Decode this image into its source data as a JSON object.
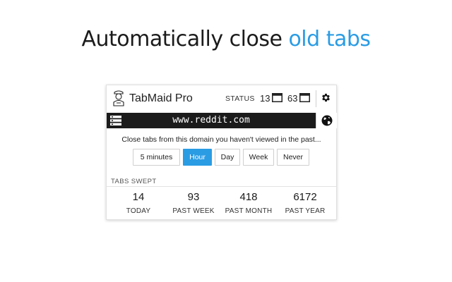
{
  "headline": {
    "prefix": "Automatically close ",
    "accent": "old tabs",
    "accent_color": "#2a9ce4"
  },
  "app": {
    "title": "TabMaid Pro",
    "logo_icon": "maid-icon"
  },
  "status": {
    "label": "STATUS",
    "count_a": "13",
    "count_b": "63",
    "window_icon": "window-icon",
    "settings_icon": "gear-icon"
  },
  "domain": {
    "text": "www.reddit.com",
    "menu_icon": "list-icon",
    "globe_icon": "globe-icon"
  },
  "prompt": "Close tabs from this domain you haven't viewed in the past...",
  "options": [
    {
      "label": "5 minutes",
      "active": false
    },
    {
      "label": "Hour",
      "active": true
    },
    {
      "label": "Day",
      "active": false
    },
    {
      "label": "Week",
      "active": false
    },
    {
      "label": "Never",
      "active": false
    }
  ],
  "swept": {
    "title": "TABS SWEPT",
    "stats": [
      {
        "value": "14",
        "label": "TODAY"
      },
      {
        "value": "93",
        "label": "PAST WEEK"
      },
      {
        "value": "418",
        "label": "PAST MONTH"
      },
      {
        "value": "6172",
        "label": "PAST YEAR"
      }
    ]
  }
}
